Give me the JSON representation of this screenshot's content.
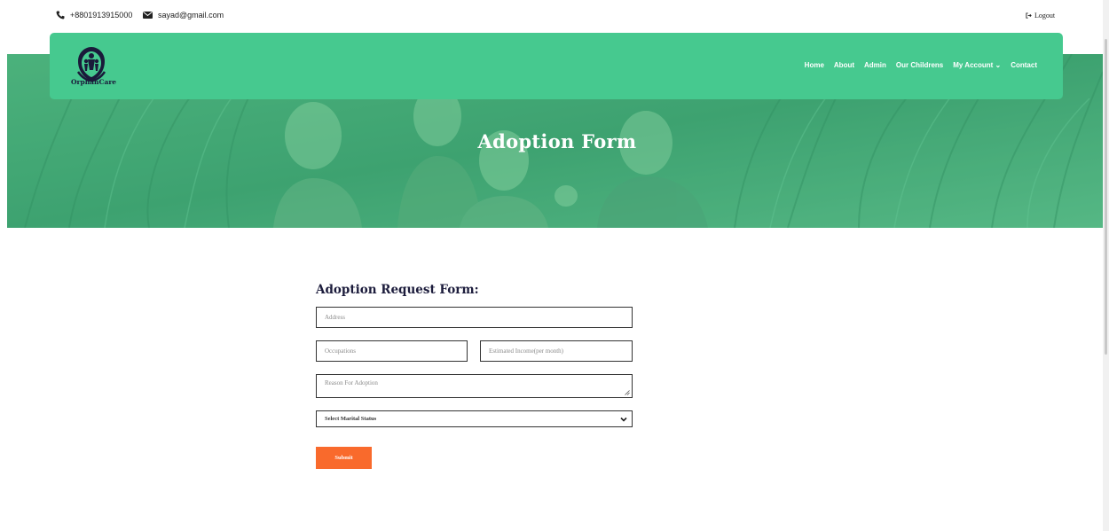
{
  "topbar": {
    "phone": "+8801913915000",
    "email": "sayad@gmail.com",
    "logout": "Logout",
    "icons": [
      "phone-icon",
      "envelope-icon",
      "logout-icon"
    ]
  },
  "brand": {
    "name": "OrphanCare",
    "logo_icon": "family-hands-logo",
    "colors": {
      "nav_bg": "#46c98f",
      "logo_dark": "#1a1a3a",
      "accent": "#f96a2c",
      "hero_overlay": "#3f9a6e"
    }
  },
  "nav": {
    "items": [
      "Home",
      "About",
      "Admin",
      "Our Childrens",
      "My Account ⌄",
      "Contact"
    ]
  },
  "hero": {
    "title": "Adoption Form"
  },
  "form": {
    "title": "Adoption Request Form:",
    "address_placeholder": "Address",
    "occupation_placeholder": "Occupations",
    "income_placeholder": "Estimated Income(per month)",
    "reason_placeholder": "Reason For Adoption",
    "marital_selected": "Select Marital Status",
    "submit_label": "Submit"
  }
}
